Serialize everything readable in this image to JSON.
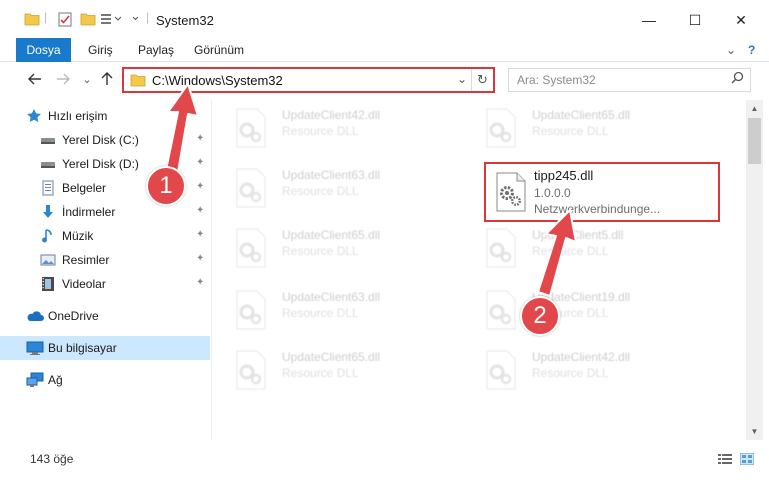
{
  "window": {
    "title": "System32",
    "minimize": "—",
    "maximize": "☐",
    "close": "✕"
  },
  "ribbon": {
    "tabs": [
      {
        "label": "Dosya",
        "active": true
      },
      {
        "label": "Giriş"
      },
      {
        "label": "Paylaş"
      },
      {
        "label": "Görünüm"
      }
    ],
    "expand_icon": "⌄",
    "help_icon": "?"
  },
  "address": {
    "path": "C:\\Windows\\System32",
    "dropdown": "⌄",
    "refresh": "↻"
  },
  "search": {
    "placeholder": "Ara: System32",
    "icon": "⌕"
  },
  "sidebar": {
    "items": [
      {
        "label": "Hızlı erişim",
        "icon": "star-icon",
        "pinned": false
      },
      {
        "label": "Yerel Disk (C:)",
        "icon": "drive-icon",
        "pinned": true
      },
      {
        "label": "Yerel Disk (D:)",
        "icon": "drive-icon",
        "pinned": true
      },
      {
        "label": "Belgeler",
        "icon": "documents-icon",
        "pinned": true
      },
      {
        "label": "İndirmeler",
        "icon": "download-icon",
        "pinned": true
      },
      {
        "label": "Müzik",
        "icon": "music-icon",
        "pinned": true
      },
      {
        "label": "Resimler",
        "icon": "pictures-icon",
        "pinned": true
      },
      {
        "label": "Videolar",
        "icon": "video-icon",
        "pinned": true
      },
      {
        "label": "OneDrive",
        "icon": "cloud-icon",
        "pinned": false
      },
      {
        "label": "Bu bilgisayar",
        "icon": "computer-icon",
        "pinned": false,
        "selected": true
      },
      {
        "label": "Ağ",
        "icon": "network-icon",
        "pinned": false
      }
    ],
    "pin_glyph": "📌"
  },
  "files": [
    {
      "name": "UpdateClient42.dll",
      "type": "Resource DLL",
      "faded": true
    },
    {
      "name": "UpdateClient65.dll",
      "type": "Resource DLL",
      "faded": true
    },
    {
      "name": "UpdateClient63.dll",
      "type": "Resource DLL",
      "faded": true
    },
    {
      "name": "tipp245.dll",
      "type": "1.0.0.0",
      "desc": "Netzwerkverbindunge...",
      "faded": false,
      "highlight": true
    },
    {
      "name": "UpdateClient65.dll",
      "type": "Resource DLL",
      "faded": true
    },
    {
      "name": "UpdateClient5.dll",
      "type": "Resource DLL",
      "faded": true
    },
    {
      "name": "UpdateClient63.dll",
      "type": "Resource DLL",
      "faded": true
    },
    {
      "name": "UpdateClient19.dll",
      "type": "Resource DLL",
      "faded": true
    },
    {
      "name": "UpdateClient65.dll",
      "type": "Resource DLL",
      "faded": true
    },
    {
      "name": "UpdateClient42.dll",
      "type": "Resource DLL",
      "faded": true
    }
  ],
  "status": {
    "count": "143 öğe"
  },
  "annotations": {
    "badge1": "1",
    "badge2": "2",
    "color": "#e2474b"
  },
  "colors": {
    "accent": "#1979ca",
    "highlight_border": "#d9363e",
    "selected_bg": "#cce8ff"
  }
}
